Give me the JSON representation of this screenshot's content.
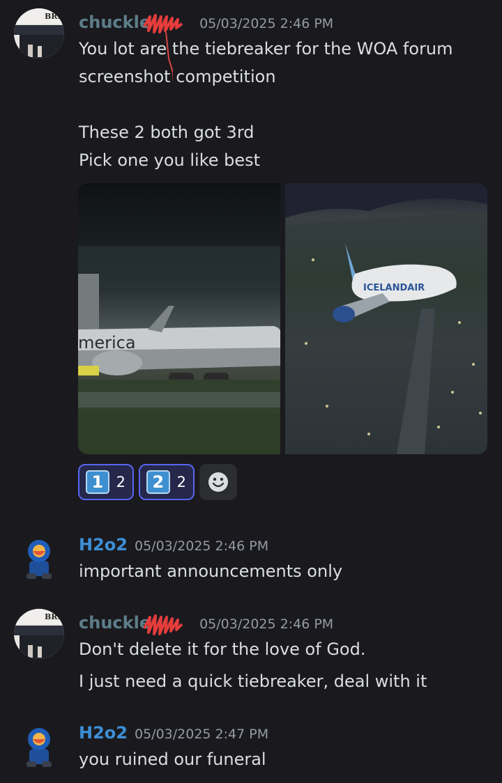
{
  "colors": {
    "background": "#1a1a1e",
    "username_chuckle": "#5d7e8a",
    "username_h2o2": "#3d8fd6",
    "reaction_border": "#5865f2",
    "redaction": "#e53c3c"
  },
  "messages": [
    {
      "author": "chuckle",
      "timestamp": "05/03/2025 2:46 PM",
      "lines": [
        "You lot are the tiebreaker for the WOA forum",
        "screenshot competition",
        "These 2 both got 3rd",
        "Pick one you like best"
      ],
      "image_texts": [
        "merica",
        "ICELANDAIR"
      ],
      "reactions": [
        {
          "emoji": "1",
          "count": "2"
        },
        {
          "emoji": "2",
          "count": "2"
        }
      ],
      "add_reaction_icon": "smiley-icon"
    },
    {
      "author": "H2o2",
      "timestamp": "05/03/2025 2:46 PM",
      "lines": [
        "important announcements only"
      ]
    },
    {
      "author": "chuckle",
      "timestamp": "05/03/2025 2:46 PM",
      "lines": [
        "Don't delete it for the love of God.",
        "I just need a quick tiebreaker, deal with it"
      ]
    },
    {
      "author": "H2o2",
      "timestamp": "05/03/2025 2:47 PM",
      "lines": [
        "you ruined our funeral"
      ]
    }
  ]
}
